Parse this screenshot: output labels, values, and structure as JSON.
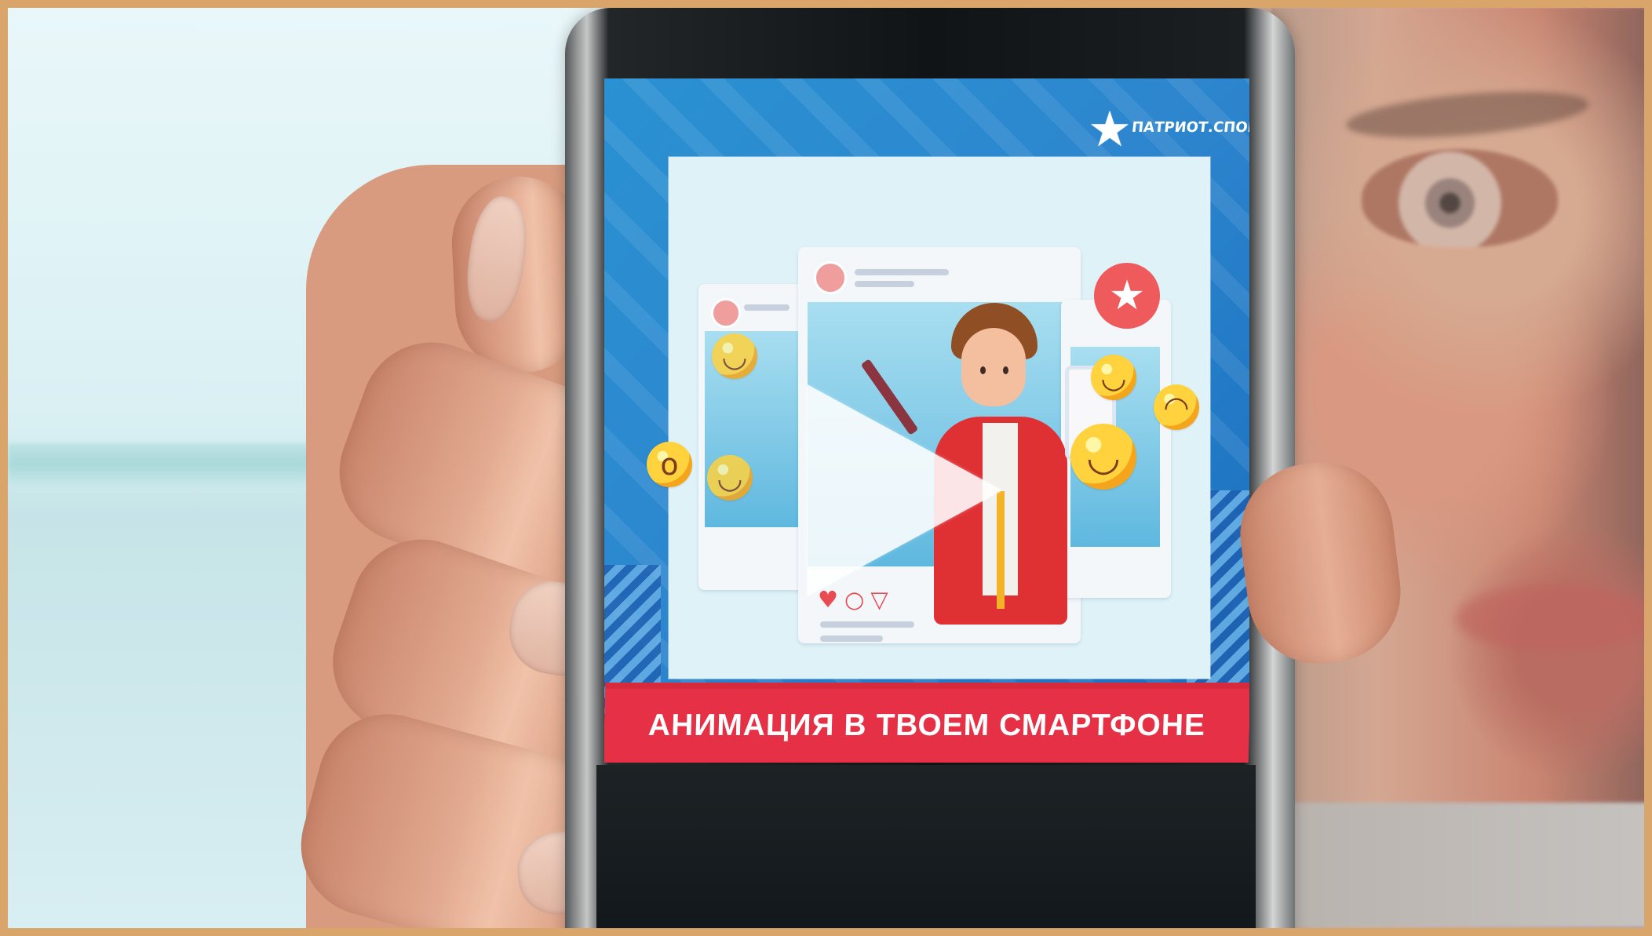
{
  "video": {
    "caption": "АНИМАЦИЯ В ТВОЕМ СМАРТФОНЕ",
    "brand": "ПАТРИОТ.СПОРТ",
    "state": "paused",
    "play_icon": "play-icon"
  },
  "colors": {
    "blue": "#2a91d2",
    "red": "#e53045",
    "white": "#ffffff",
    "skin": "#d89b7f"
  },
  "icons": {
    "logo": "star-logo-icon",
    "favorite": "star-badge-icon",
    "like": "heart-icon",
    "comment": "comment-icon",
    "share": "send-icon",
    "bookmark": "bookmark-icon"
  }
}
